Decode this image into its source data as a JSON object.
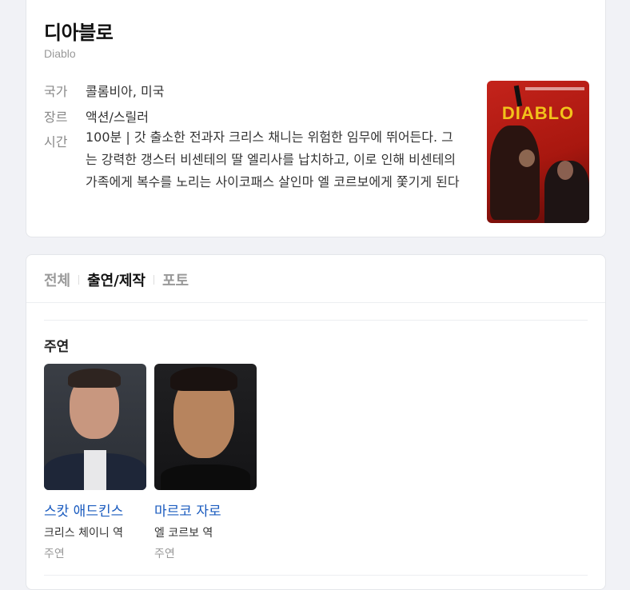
{
  "movie": {
    "title": "디아블로",
    "original_title": "Diablo",
    "country_label": "국가",
    "country": "콜롬비아, 미국",
    "genre_label": "장르",
    "genre": "액션/스릴러",
    "runtime_label": "시간",
    "runtime_summary": "100분 | 갓 출소한 전과자 크리스 채니는 위험한 임무에 뛰어든다. 그는 강력한 갱스터 비센테의 딸 엘리사를 납치하고, 이로 인해 비센테의 가족에게 복수를 노리는 사이코패스 살인마 엘 코르보에게 쫓기게 된다",
    "poster_text": "DIABLO"
  },
  "tabs": [
    {
      "label": "전체",
      "active": false
    },
    {
      "label": "출연/제작",
      "active": true
    },
    {
      "label": "포토",
      "active": false
    }
  ],
  "cast": {
    "section_title": "주연",
    "people": [
      {
        "name": "스캇 애드킨스",
        "role": "크리스 체이니 역",
        "type": "주연"
      },
      {
        "name": "마르코 자로",
        "role": "엘 코르보 역",
        "type": "주연"
      }
    ]
  },
  "colors": {
    "link": "#1a5bbf",
    "poster_red": "#c4231b",
    "poster_title": "#f2c21b"
  }
}
